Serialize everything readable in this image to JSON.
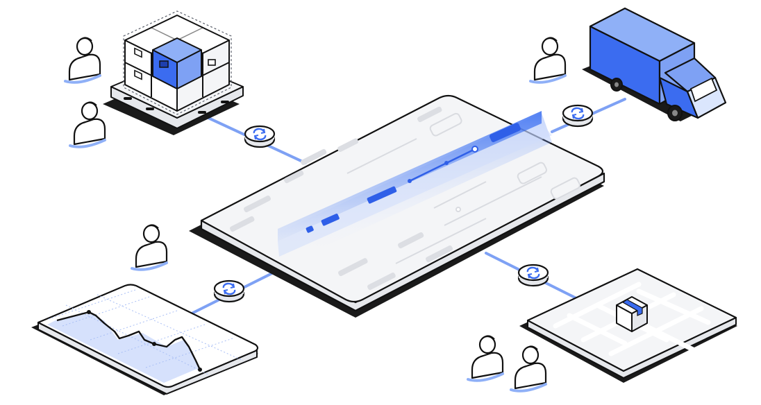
{
  "illustration": {
    "palette": {
      "outline": "#111111",
      "accent": "#3b6cf0",
      "accent_light": "#8fb0f7",
      "accent_pale": "#dbe6fd",
      "accent_fill": "#7ea1f4",
      "panel": "#f4f5f7",
      "panel_side": "#e6e8ec",
      "shadow": "#1a1a1a",
      "placeholder": "#d9dbe0",
      "white": "#ffffff"
    },
    "scene": {
      "hub": "central-dashboard",
      "nodes": [
        "warehouse-pallet",
        "delivery-truck",
        "analytics-chart",
        "map-tracking"
      ],
      "connector_icon": "sync-icon",
      "people_icon": "person-icon"
    }
  }
}
